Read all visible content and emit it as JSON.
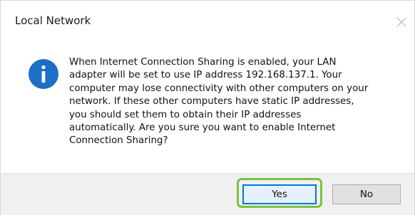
{
  "window": {
    "title": "Local Network"
  },
  "icons": {
    "close": "close-icon",
    "info": "info-icon"
  },
  "message": {
    "text": "When Internet Connection Sharing is enabled, your LAN\nadapter will be set to use IP address 192.168.137.1. Your\ncomputer may lose connectivity with other computers on your\nnetwork. If these other computers have static IP addresses,\nyou should set them to obtain their IP addresses\nautomatically.  Are you sure you want to enable Internet\nConnection Sharing?"
  },
  "buttons": {
    "yes_label": "Yes",
    "no_label": "No"
  },
  "colors": {
    "info_icon": "#1c6fc4",
    "default_button_border": "#0078d7",
    "highlight": "#7ac143",
    "footer_background": "#f0f0f0"
  }
}
